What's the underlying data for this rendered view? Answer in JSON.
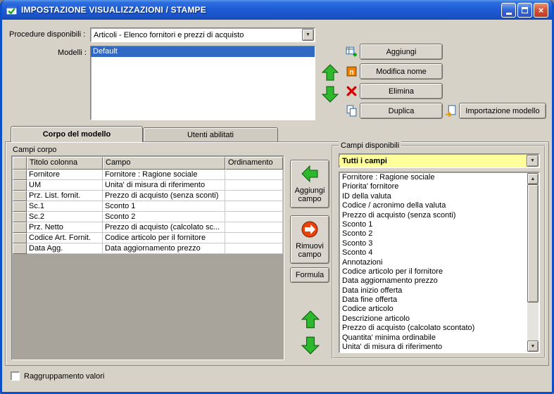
{
  "colors": {
    "titlebar_blue": "#1E5CD6",
    "window_border_blue": "#0C4FC8",
    "dialog_bg": "#D6D2C8",
    "selection_blue": "#316AC5",
    "filter_yellow": "#FFFF9B",
    "arrow_green": "#2EB82E",
    "remove_orange": "#E8420A",
    "grid_empty_gray": "#A8A49C"
  },
  "titlebar": {
    "title": "IMPOSTAZIONE VISUALIZZAZIONI / STAMPE"
  },
  "top_panel": {
    "procedure_label": "Procedure disponibili :",
    "procedure_value": "Articoli - Elenco fornitori e prezzi di acquisto",
    "modelli_label": "Modelli :",
    "modelli_items": [
      "Default"
    ],
    "modelli_selected_index": 0,
    "buttons": {
      "aggiungi": "Aggiungi",
      "modifica_nome": "Modifica nome",
      "elimina": "Elimina",
      "duplica": "Duplica",
      "importazione_modello": "Importazione modello"
    }
  },
  "tabs": {
    "corpo": "Corpo del modello",
    "utenti": "Utenti abilitati"
  },
  "corpo_tab": {
    "campi_corpo_label": "Campi corpo",
    "grid": {
      "columns": [
        "Titolo colonna",
        "Campo",
        "Ordinamento"
      ],
      "rows": [
        [
          "Fornitore",
          "Fornitore : Ragione sociale",
          ""
        ],
        [
          "UM",
          "Unita' di misura di riferimento",
          ""
        ],
        [
          "Prz. List. fornit.",
          "Prezzo di acquisto (senza sconti)",
          ""
        ],
        [
          "Sc.1",
          "Sconto 1",
          ""
        ],
        [
          "Sc.2",
          "Sconto 2",
          ""
        ],
        [
          "Prz. Netto",
          "Prezzo di acquisto (calcolato sc...",
          ""
        ],
        [
          "Codice Art. Fornit.",
          "Codice articolo per il fornitore",
          ""
        ],
        [
          "Data Agg.",
          "Data aggiornamento prezzo",
          ""
        ]
      ]
    },
    "buttons": {
      "aggiungi_campo": "Aggiungi campo",
      "rimuovi_campo": "Rimuovi campo",
      "formula": "Formula"
    },
    "campi_disponibili": {
      "label": "Campi disponibili",
      "filter": "Tutti i campi",
      "items": [
        "Fornitore : Ragione sociale",
        "Priorita' fornitore",
        "ID della valuta",
        "Codice / acronimo della valuta",
        "Prezzo di acquisto (senza sconti)",
        "Sconto 1",
        "Sconto 2",
        "Sconto 3",
        "Sconto 4",
        "Annotazioni",
        "Codice articolo per il fornitore",
        "Data aggiornamento prezzo",
        "Data inizio offerta",
        "Data fine offerta",
        "Codice articolo",
        "Descrizione articolo",
        "Prezzo di acquisto (calcolato scontato)",
        "Quantita' minima ordinabile",
        "Unita' di misura di riferimento"
      ]
    }
  },
  "footer": {
    "raggruppamento_label": "Raggruppamento valori",
    "raggruppamento_checked": false
  }
}
